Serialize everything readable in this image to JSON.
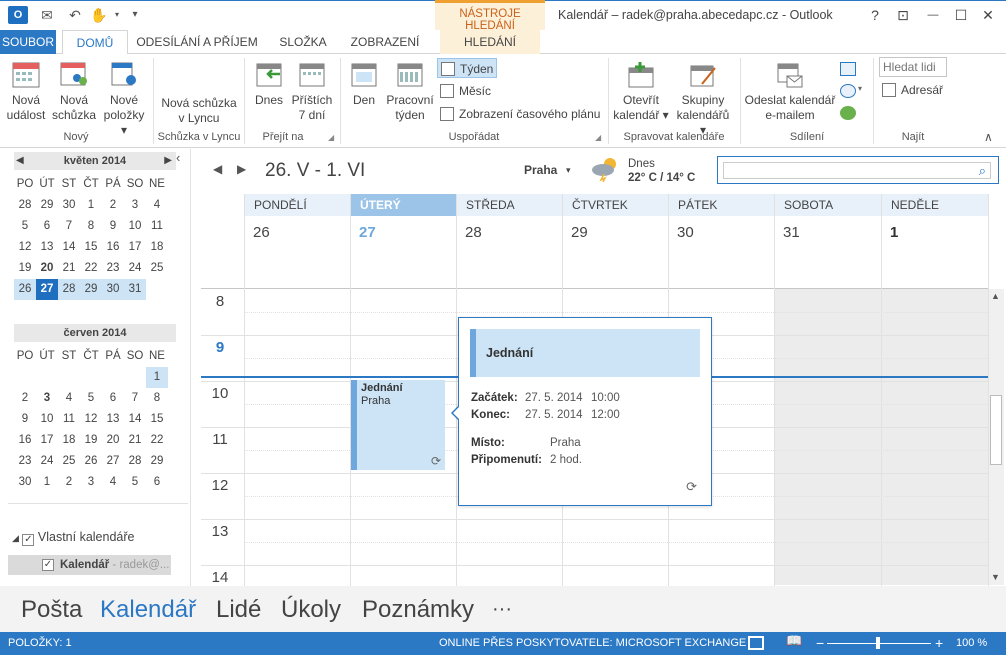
{
  "titlebar": {
    "window_title": "Kalendář – radek@praha.abecedapc.cz - Outlook",
    "context_tab_group": "NÁSTROJE HLEDÁNÍ",
    "help": "?",
    "restore_ribbon": "⊡",
    "minimize": "—",
    "maximize": "☐",
    "close": "✕"
  },
  "tabs": {
    "file": "SOUBOR",
    "home": "DOMŮ",
    "send_receive": "ODESÍLÁNÍ A PŘÍJEM",
    "folder": "SLOŽKA",
    "view": "ZOBRAZENÍ",
    "search": "HLEDÁNÍ"
  },
  "ribbon": {
    "new_event_1": "Nová",
    "new_event_2": "událost",
    "new_meeting_1": "Nová",
    "new_meeting_2": "schůzka",
    "new_items_1": "Nové",
    "new_items_2": "položky ▾",
    "group_new": "Nový",
    "lync_1": "Nová schůzka",
    "lync_2": "v Lyncu",
    "group_lync": "Schůzka v Lyncu",
    "today": "Dnes",
    "next7_1": "Příštích",
    "next7_2": "7 dní",
    "group_goto": "Přejít na",
    "day": "Den",
    "workweek_1": "Pracovní",
    "workweek_2": "týden",
    "week": "Týden",
    "month": "Měsíc",
    "schedule": "Zobrazení časového plánu",
    "group_arrange": "Uspořádat",
    "open_cal_1": "Otevřít",
    "open_cal_2": "kalendář ▾",
    "cal_groups_1": "Skupiny",
    "cal_groups_2": "kalendářů ▾",
    "group_manage": "Spravovat kalendáře",
    "email_cal_1": "Odeslat kalendář",
    "email_cal_2": "e-mailem",
    "group_share": "Sdílení",
    "search_people": "Hledat lidi",
    "address_book": "Adresář",
    "group_find": "Najít",
    "collapse": "∧"
  },
  "mini_cal_may": {
    "title": "květen 2014",
    "dow": [
      "PO",
      "ÚT",
      "ST",
      "ČT",
      "PÁ",
      "SO",
      "NE"
    ],
    "weeks": [
      [
        "28",
        "29",
        "30",
        "1",
        "2",
        "3",
        "4"
      ],
      [
        "5",
        "6",
        "7",
        "8",
        "9",
        "10",
        "11"
      ],
      [
        "12",
        "13",
        "14",
        "15",
        "16",
        "17",
        "18"
      ],
      [
        "19",
        "20",
        "21",
        "22",
        "23",
        "24",
        "25"
      ],
      [
        "26",
        "27",
        "28",
        "29",
        "30",
        "31",
        ""
      ]
    ]
  },
  "mini_cal_june": {
    "title": "červen 2014",
    "dow": [
      "PO",
      "ÚT",
      "ST",
      "ČT",
      "PÁ",
      "SO",
      "NE"
    ],
    "weeks": [
      [
        "",
        "",
        "",
        "",
        "",
        "",
        "1"
      ],
      [
        "2",
        "3",
        "4",
        "5",
        "6",
        "7",
        "8"
      ],
      [
        "9",
        "10",
        "11",
        "12",
        "13",
        "14",
        "15"
      ],
      [
        "16",
        "17",
        "18",
        "19",
        "20",
        "21",
        "22"
      ],
      [
        "23",
        "24",
        "25",
        "26",
        "27",
        "28",
        "29"
      ],
      [
        "30",
        "1",
        "2",
        "3",
        "4",
        "5",
        "6"
      ]
    ]
  },
  "folders": {
    "group": "Vlastní kalendáře",
    "calendar_name": "Kalendář",
    "calendar_owner": "- radek@..."
  },
  "header": {
    "range": "26. V - 1. VI",
    "city": "Praha",
    "weather_today": "Dnes",
    "weather_temp": "22° C / 14° C"
  },
  "days": [
    {
      "name": "PONDĚLÍ",
      "num": "26"
    },
    {
      "name": "ÚTERÝ",
      "num": "27"
    },
    {
      "name": "STŘEDA",
      "num": "28"
    },
    {
      "name": "ČTVRTEK",
      "num": "29"
    },
    {
      "name": "PÁTEK",
      "num": "30"
    },
    {
      "name": "SOBOTA",
      "num": "31"
    },
    {
      "name": "NEDĚLE",
      "num": "1"
    }
  ],
  "hours": [
    "8",
    "9",
    "10",
    "11",
    "12",
    "13",
    "14"
  ],
  "appointment": {
    "title": "Jednání",
    "location": "Praha"
  },
  "popup": {
    "title": "Jednání",
    "start_label": "Začátek:",
    "start_date": "27. 5. 2014",
    "start_time": "10:00",
    "end_label": "Konec:",
    "end_date": "27. 5. 2014",
    "end_time": "12:00",
    "place_label": "Místo:",
    "place": "Praha",
    "reminder_label": "Připomenutí:",
    "reminder": "2 hod."
  },
  "navbar": {
    "mail": "Pošta",
    "calendar": "Kalendář",
    "people": "Lidé",
    "tasks": "Úkoly",
    "notes": "Poznámky",
    "more": "···"
  },
  "statusbar": {
    "items": "POLOŽKY: 1",
    "connection": "ONLINE PŘES POSKYTOVATELE: MICROSOFT EXCHANGE",
    "zoom": "100 %",
    "zoom_minus": "−",
    "zoom_plus": "+"
  },
  "colors": {
    "accent": "#2b78c5",
    "today": "#1e6fc0",
    "week_highlight": "#cde4f7",
    "appointment": "#cde4f7"
  }
}
